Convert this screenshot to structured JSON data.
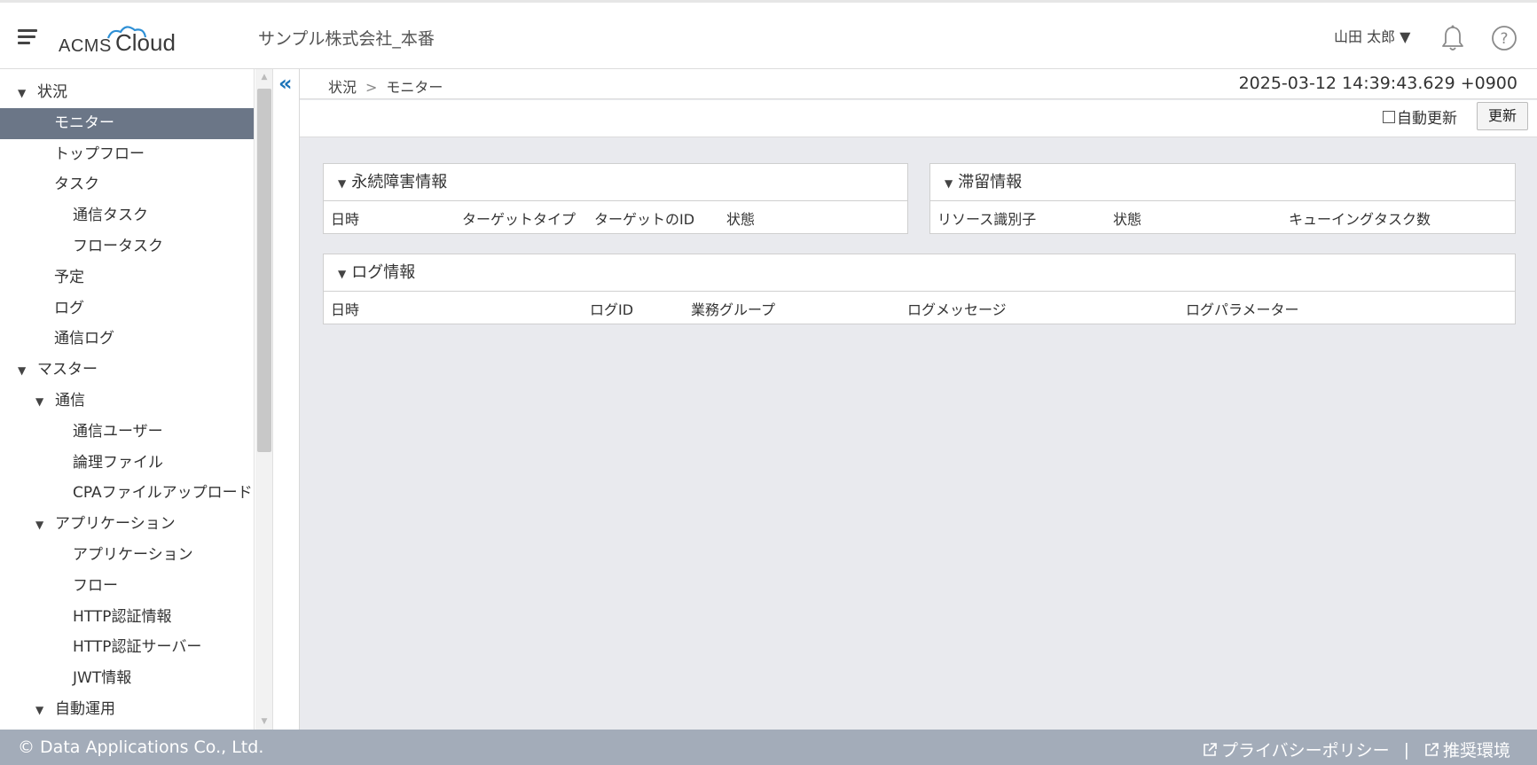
{
  "header": {
    "logo_acms": "ACMS",
    "logo_cloud": "Cloud",
    "company": "サンプル株式会社_本番",
    "user_menu": "山田 太郎 ▼"
  },
  "sidebar": {
    "items": [
      {
        "label": "状況",
        "level": 0,
        "expandable": true,
        "active": false
      },
      {
        "label": "モニター",
        "level": 1,
        "expandable": false,
        "active": true
      },
      {
        "label": "トップフロー",
        "level": 1,
        "expandable": false,
        "active": false
      },
      {
        "label": "タスク",
        "level": 1,
        "expandable": false,
        "active": false
      },
      {
        "label": "通信タスク",
        "level": 2,
        "expandable": false,
        "active": false
      },
      {
        "label": "フロータスク",
        "level": 2,
        "expandable": false,
        "active": false
      },
      {
        "label": "予定",
        "level": 1,
        "expandable": false,
        "active": false
      },
      {
        "label": "ログ",
        "level": 1,
        "expandable": false,
        "active": false
      },
      {
        "label": "通信ログ",
        "level": 1,
        "expandable": false,
        "active": false
      },
      {
        "label": "マスター",
        "level": 0,
        "expandable": true,
        "active": false
      },
      {
        "label": "通信",
        "level": 1,
        "expandable": true,
        "active": false
      },
      {
        "label": "通信ユーザー",
        "level": 2,
        "expandable": false,
        "active": false
      },
      {
        "label": "論理ファイル",
        "level": 2,
        "expandable": false,
        "active": false
      },
      {
        "label": "CPAファイルアップロード",
        "level": 2,
        "expandable": false,
        "active": false
      },
      {
        "label": "アプリケーション",
        "level": 1,
        "expandable": true,
        "active": false
      },
      {
        "label": "アプリケーション",
        "level": 2,
        "expandable": false,
        "active": false
      },
      {
        "label": "フロー",
        "level": 2,
        "expandable": false,
        "active": false
      },
      {
        "label": "HTTP認証情報",
        "level": 2,
        "expandable": false,
        "active": false
      },
      {
        "label": "HTTP認証サーバー",
        "level": 2,
        "expandable": false,
        "active": false
      },
      {
        "label": "JWT情報",
        "level": 2,
        "expandable": false,
        "active": false
      },
      {
        "label": "自動運用",
        "level": 1,
        "expandable": true,
        "active": false
      }
    ]
  },
  "main": {
    "breadcrumb": [
      "状況",
      "モニター"
    ],
    "breadcrumb_sep": ">",
    "timestamp": "2025-03-12 14:39:43.629 +0900",
    "auto_refresh_label": "自動更新",
    "auto_refresh_checked": false,
    "refresh_label": "更新",
    "panels": {
      "fault": {
        "title": "永続障害情報",
        "columns": [
          "日時",
          "ターゲットタイプ",
          "ターゲットのID",
          "状態"
        ]
      },
      "stagnation": {
        "title": "滞留情報",
        "columns": [
          "リソース識別子",
          "状態",
          "キューイングタスク数"
        ]
      },
      "log": {
        "title": "ログ情報",
        "columns": [
          "日時",
          "ログID",
          "業務グループ",
          "ログメッセージ",
          "ログパラメーター"
        ]
      }
    }
  },
  "footer": {
    "copyright": "© Data Applications Co., Ltd.",
    "privacy": "プライバシーポリシー",
    "pipe": "|",
    "recommended": "推奨環境"
  },
  "icons": {
    "menu": "hamburger-icon",
    "bell": "bell-icon",
    "help": "help-icon",
    "collapse": "double-chevron-left-icon",
    "external": "external-link-icon"
  },
  "colors": {
    "active_nav": "#6b7687",
    "accent": "#1a73b8",
    "footer_bg": "#a3acb9",
    "main_bg": "#e9eaee"
  }
}
